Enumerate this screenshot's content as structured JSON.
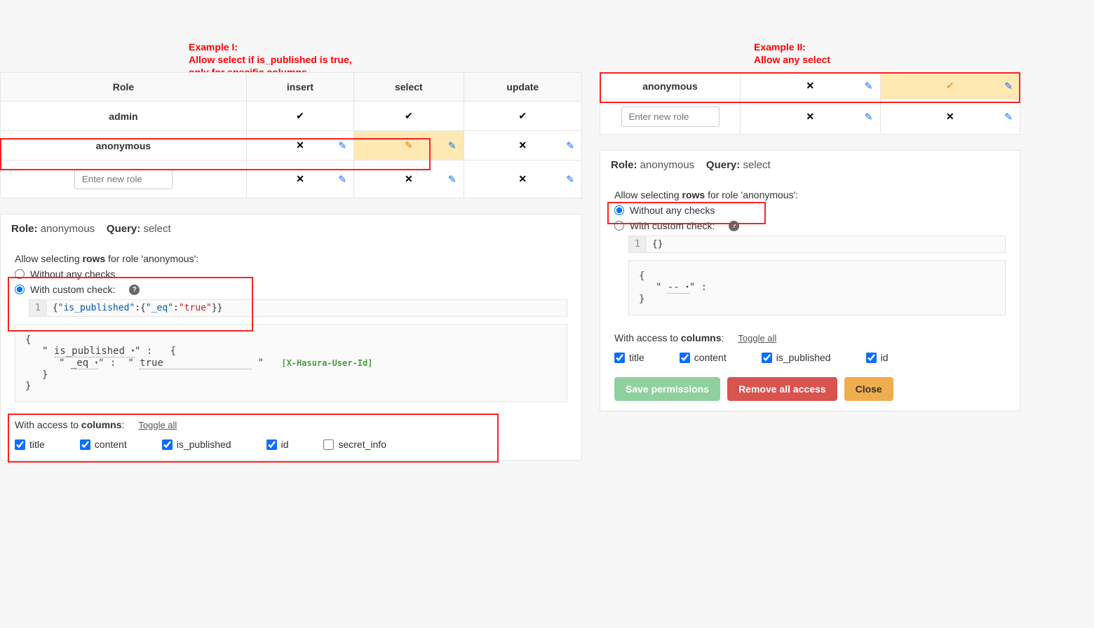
{
  "annotations": {
    "ex1_line1": "Example I:",
    "ex1_line2": "Allow select if is_published is true,",
    "ex1_line3": "only for specific columns",
    "ex2_line1": "Example II:",
    "ex2_line2": "Allow any select"
  },
  "table_left": {
    "headers": {
      "role": "Role",
      "insert": "insert",
      "select": "select",
      "update": "update"
    },
    "rows": {
      "admin": "admin",
      "anonymous": "anonymous"
    },
    "new_role_placeholder": "Enter new role"
  },
  "table_right": {
    "rows": {
      "anonymous": "anonymous"
    },
    "new_role_placeholder": "Enter new role"
  },
  "section": {
    "head_role_label": "Role:",
    "head_role": "anonymous",
    "head_query_label": "Query:",
    "head_query": "select",
    "allow_prefix": "Allow selecting ",
    "allow_bold": "rows",
    "allow_suffix": " for role 'anonymous':",
    "radio_without": "Without any checks",
    "radio_custom": "With custom check:",
    "json_lineno": "1",
    "json_pre": "{",
    "json_k1": "\"is_published\"",
    "json_mid": ":{",
    "json_k2": "\"_eq\"",
    "json_mid2": ":",
    "json_v": "\"true\"",
    "json_post": "}}",
    "builder": {
      "open": "{",
      "key": "is_published",
      "sep": "\" :",
      "brace": "{",
      "eq": "_eq",
      "sep2": "\" :",
      "q": "\"",
      "true": "true",
      "q2": "\"",
      "hint": "[X-Hasura-User-Id]",
      "close": "}",
      "close2": "}"
    },
    "cols_prefix": "With access to ",
    "cols_bold": "columns",
    "cols_suffix": ":",
    "toggle": "Toggle all",
    "cols": {
      "title": "title",
      "content": "content",
      "is_published": "is_published",
      "id": "id",
      "secret": "secret_info"
    },
    "btns": {
      "save": "Save permissions",
      "remove": "Remove all access",
      "close": "Close"
    }
  },
  "right_code": {
    "lineno": "1",
    "content": "{}",
    "builder_open": "{",
    "builder_dash": "--",
    "builder_sep": "\" :",
    "builder_close": "}"
  }
}
